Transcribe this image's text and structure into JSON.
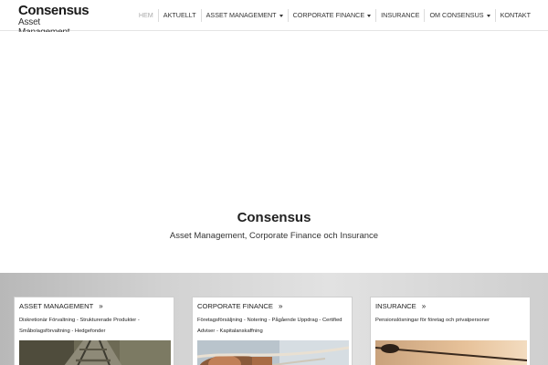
{
  "logo": {
    "main": "Consensus",
    "sub": "Asset Management"
  },
  "nav": {
    "items": [
      {
        "label": "HEM",
        "active": true,
        "dropdown": false
      },
      {
        "label": "AKTUELLT",
        "active": false,
        "dropdown": false
      },
      {
        "label": "ASSET MANAGEMENT",
        "active": false,
        "dropdown": true
      },
      {
        "label": "CORPORATE FINANCE",
        "active": false,
        "dropdown": true
      },
      {
        "label": "INSURANCE",
        "active": false,
        "dropdown": false
      },
      {
        "label": "OM CONSENSUS",
        "active": false,
        "dropdown": true
      },
      {
        "label": "KONTAKT",
        "active": false,
        "dropdown": false
      }
    ]
  },
  "hero": {
    "title": "Consensus",
    "subtitle": "Asset Management, Corporate Finance och Insurance"
  },
  "cards": [
    {
      "title": "ASSET MANAGEMENT",
      "text": "Diskretionär Förvaltning - Strukturerade Produkter - Småbolagsförvaltning - Hedgefonder",
      "image_icon": "railway-track-photo"
    },
    {
      "title": "CORPORATE FINANCE",
      "text": "Företagsförsäljning - Notering - Pågående Uppdrag - Certified Adviser - Kapitalanskaffning",
      "image_icon": "rope-climbing-photo"
    },
    {
      "title": "INSURANCE",
      "text": "Pensionslösningar för företag och privatpersoner",
      "image_icon": "paddle-sunset-photo"
    }
  ],
  "colors": {
    "header_border": "#e4e4e4",
    "active_nav": "#aaaaaa",
    "text": "#222222"
  }
}
